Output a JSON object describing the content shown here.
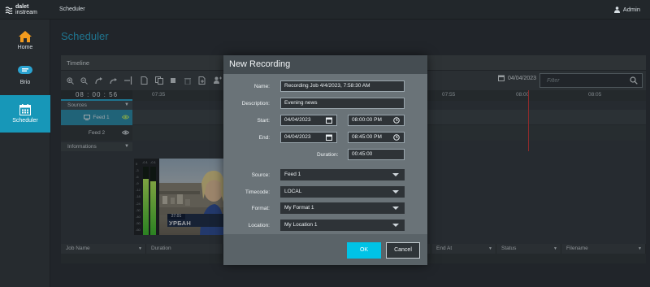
{
  "header": {
    "logo_line1": "dalet",
    "logo_line2": "instream",
    "app_title": "Scheduler",
    "user": "Admin"
  },
  "nav": {
    "home": "Home",
    "brio": "Brio",
    "scheduler": "Scheduler"
  },
  "page": {
    "title": "Scheduler"
  },
  "timeline": {
    "title": "Timeline",
    "current_time": "08 : 00 : 56",
    "date": "04/04/2023",
    "filter_placeholder": "Filter",
    "ticks": [
      "07:35",
      "07:55",
      "08:00",
      "08:05"
    ]
  },
  "sources": {
    "header": "Sources",
    "feeds": [
      "Feed 1",
      "Feed 2"
    ],
    "informations": "Informations"
  },
  "preview": {
    "meter_labels": [
      "-0.1",
      "-0.1"
    ],
    "meter_levels": [
      0.82,
      0.78
    ],
    "meter_scale": [
      "0",
      "-3",
      "-6",
      "-9",
      "-12",
      "-18",
      "-24",
      "-30",
      "-40",
      "-50",
      "-60"
    ],
    "lower_third_tag": "27.01",
    "lower_third_text": "УРБАН"
  },
  "grid": {
    "columns": [
      "Job Name",
      "Duration",
      "",
      "",
      "",
      "",
      "",
      "End At",
      "Status",
      "Filename"
    ]
  },
  "dialog": {
    "title": "New Recording",
    "labels": {
      "name": "Name:",
      "description": "Description:",
      "start": "Start:",
      "end": "End:",
      "duration": "Duration:",
      "source": "Source:",
      "timecode": "Timecode:",
      "format": "Format:",
      "location": "Location:"
    },
    "values": {
      "name": "Recording Job 4/4/2023, 7:58:30 AM",
      "description": "Evening news",
      "start_date": "04/04/2023",
      "start_time": "08:00:00 PM",
      "end_date": "04/04/2023",
      "end_time": "08:45:00 PM",
      "duration": "00:45:00",
      "source": "Feed 1",
      "timecode": "LOCAL",
      "format": "My Format 1",
      "location": "My Location 1"
    },
    "ok": "OK",
    "cancel": "Cancel"
  },
  "colors": {
    "accent": "#29a9d1",
    "ok_button": "#00c3e6",
    "now_line": "#d23a3a"
  }
}
